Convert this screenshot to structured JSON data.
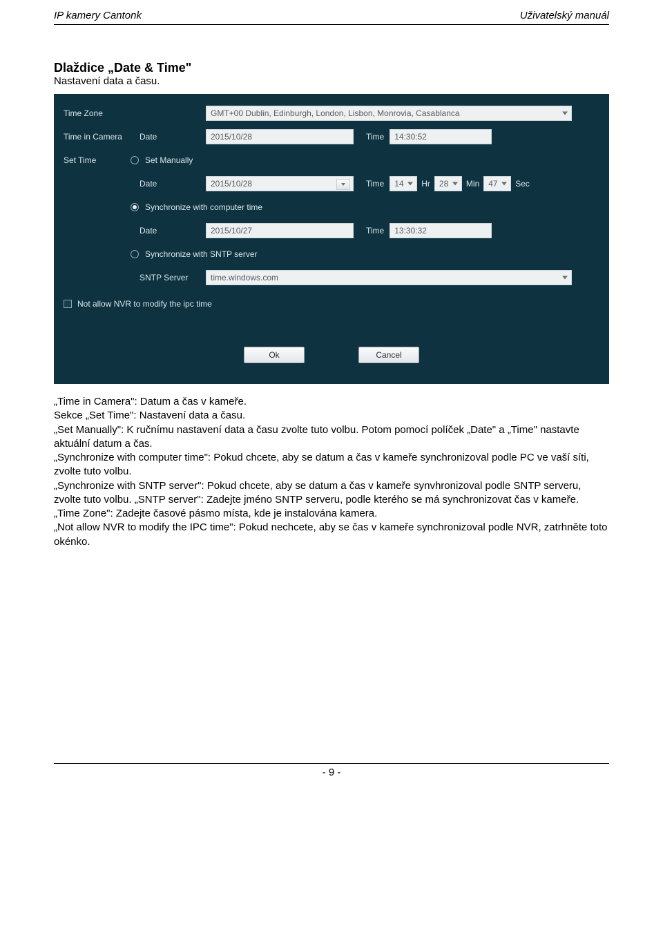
{
  "header": {
    "left": "IP kamery Cantonk",
    "right": "Uživatelský manuál"
  },
  "section": {
    "title": "Dlaždice „Date & Time\"",
    "subtitle": "Nastavení data a času."
  },
  "panel": {
    "labels": {
      "timezone": "Time Zone",
      "time_in_camera": "Time in Camera",
      "set_time": "Set Time",
      "date": "Date",
      "time": "Time",
      "hr": "Hr",
      "min": "Min",
      "sec": "Sec",
      "sntp_server": "SNTP Server"
    },
    "timezone_value": "GMT+00 Dublin, Edinburgh, London, Lisbon, Monrovia, Casablanca",
    "camera": {
      "date": "2015/10/28",
      "time": "14:30:52"
    },
    "options": {
      "set_manually": {
        "label": "Set Manually",
        "selected": false,
        "date": "2015/10/28",
        "hr": "14",
        "min": "28",
        "sec": "47"
      },
      "sync_computer": {
        "label": "Synchronize with computer time",
        "selected": true,
        "date": "2015/10/27",
        "time": "13:30:32"
      },
      "sync_sntp": {
        "label": "Synchronize with SNTP server",
        "selected": false,
        "server": "time.windows.com"
      }
    },
    "nvr_checkbox": {
      "checked": false,
      "label": "Not allow NVR to modify the ipc time"
    },
    "buttons": {
      "ok": "Ok",
      "cancel": "Cancel"
    }
  },
  "body": {
    "p1": "„Time in Camera\": Datum a čas v kameře.",
    "p2": "Sekce „Set Time\": Nastavení data a času.",
    "p3": "„Set Manually\": K ručnímu nastavení data a času zvolte tuto volbu. Potom pomocí políček „Date\" a „Time\" nastavte aktuální datum a čas.",
    "p4": "„Synchronize with computer time\": Pokud chcete, aby se datum a čas v kameře synchronizoval podle PC ve vaší síti, zvolte tuto volbu.",
    "p5": "„Synchronize with SNTP server\": Pokud chcete, aby se datum a čas v kameře synvhronizoval podle SNTP serveru, zvolte tuto volbu. „SNTP server\": Zadejte jméno SNTP serveru, podle kterého se má synchronizovat čas v kameře.",
    "p6": "„Time Zone\": Zadejte časové pásmo místa, kde je instalována kamera.",
    "p7": "„Not allow NVR to modify the IPC time\": Pokud nechcete, aby se čas v kameře synchronizoval podle NVR, zatrhněte toto okénko."
  },
  "footer": {
    "page": "- 9 -"
  }
}
